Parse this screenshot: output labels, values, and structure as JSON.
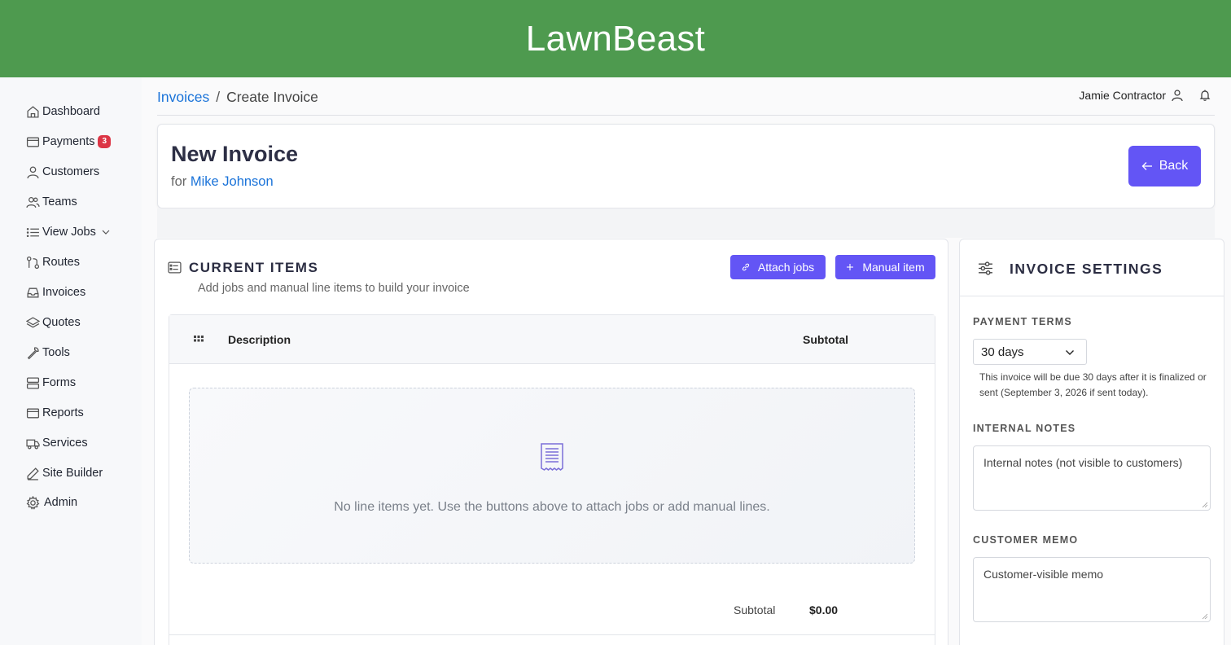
{
  "app": {
    "brand": "LawnBeast"
  },
  "sidebar": {
    "items": [
      {
        "label": "Dashboard",
        "icon": "home-icon"
      },
      {
        "label": "Payments",
        "icon": "credit-card-icon",
        "badge": "3"
      },
      {
        "label": "Customers",
        "icon": "user-icon"
      },
      {
        "label": "Teams",
        "icon": "users-icon"
      },
      {
        "label": "View Jobs",
        "icon": "list-icon",
        "has_dropdown": true
      },
      {
        "label": "Routes",
        "icon": "route-icon"
      },
      {
        "label": "Invoices",
        "icon": "inbox-icon"
      },
      {
        "label": "Quotes",
        "icon": "layers-icon"
      },
      {
        "label": "Tools",
        "icon": "wrench-icon"
      },
      {
        "label": "Forms",
        "icon": "forms-icon"
      },
      {
        "label": "Reports",
        "icon": "reports-icon"
      },
      {
        "label": "Services",
        "icon": "truck-icon"
      },
      {
        "label": "Site Builder",
        "icon": "pen-icon"
      },
      {
        "label": "Admin",
        "icon": "gear-icon"
      }
    ]
  },
  "breadcrumb": {
    "parent": "Invoices",
    "separator": "/",
    "current": "Create Invoice"
  },
  "user": {
    "name": "Jamie Contractor"
  },
  "header": {
    "title": "New Invoice",
    "for_prefix": "for",
    "customer": "Mike Johnson",
    "back_label": "Back"
  },
  "items": {
    "title": "CURRENT ITEMS",
    "subtitle": "Add jobs and manual line items to build your invoice",
    "attach_label": "Attach jobs",
    "manual_label": "Manual item",
    "columns": {
      "description": "Description",
      "subtotal": "Subtotal"
    },
    "empty_text": "No line items yet. Use the buttons above to attach jobs or add manual lines.",
    "subtotal_label": "Subtotal",
    "subtotal_value": "$0.00"
  },
  "settings": {
    "title": "INVOICE SETTINGS",
    "payment_terms_label": "PAYMENT TERMS",
    "payment_terms_value": "30 days",
    "payment_terms_help": "This invoice will be due 30 days after it is finalized or sent (September 3, 2026 if sent today).",
    "internal_notes_label": "INTERNAL NOTES",
    "internal_notes_placeholder": "Internal notes (not visible to customers)",
    "customer_memo_label": "CUSTOMER MEMO",
    "customer_memo_placeholder": "Customer-visible memo"
  },
  "colors": {
    "header_green": "#4e9a4f",
    "accent": "#6355f5",
    "link": "#1a73d9",
    "badge": "#dc3545"
  }
}
